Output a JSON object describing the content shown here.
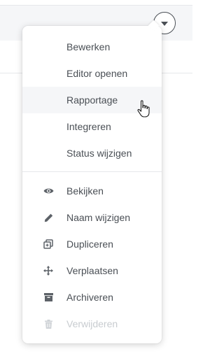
{
  "menu": {
    "primary_items": [
      {
        "label": "Bewerken"
      },
      {
        "label": "Editor openen"
      },
      {
        "label": "Rapportage"
      },
      {
        "label": "Integreren"
      },
      {
        "label": "Status wijzigen"
      }
    ],
    "secondary_items": [
      {
        "label": "Bekijken",
        "icon": "eye-icon"
      },
      {
        "label": "Naam wijzigen",
        "icon": "pencil-icon"
      },
      {
        "label": "Dupliceren",
        "icon": "duplicate-icon"
      },
      {
        "label": "Verplaatsen",
        "icon": "move-icon"
      },
      {
        "label": "Archiveren",
        "icon": "archive-icon"
      },
      {
        "label": "Verwijderen",
        "icon": "trash-icon",
        "disabled": true
      }
    ],
    "highlighted_item": "Rapportage"
  },
  "trigger": {
    "icon": "chevron-down-icon"
  },
  "colors": {
    "text": "#4a4f55",
    "disabled_text": "#c8ccd0",
    "hover_background": "#f5f6f8",
    "divider": "#e6e8eb"
  }
}
